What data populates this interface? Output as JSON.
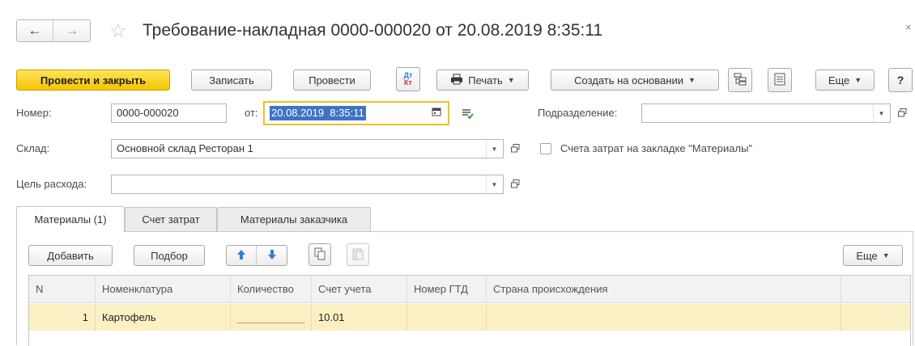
{
  "window": {
    "title": "Требование-накладная 0000-000020 от 20.08.2019 8:35:11",
    "back_icon": "arrow-left-icon",
    "forward_icon": "arrow-right-icon",
    "favorite_icon": "star-icon",
    "close_icon": "close-icon"
  },
  "toolbar": {
    "post_and_close": "Провести и закрыть",
    "save": "Записать",
    "post": "Провести",
    "dt_kt_top": "Дт",
    "dt_kt_bottom": "Кт",
    "print": "Печать",
    "create_based_on": "Создать на основании",
    "more": "Еще",
    "help": "?"
  },
  "form": {
    "number_label": "Номер:",
    "number_value": "0000-000020",
    "date_label": "от:",
    "date_value": "20.08.2019  8:35:11",
    "division_label": "Подразделение:",
    "division_value": "",
    "warehouse_label": "Склад:",
    "warehouse_value": "Основной склад Ресторан 1",
    "cost_accounts_checkbox_label": "Счета затрат на закладке \"Материалы\"",
    "cost_accounts_checked": false,
    "purpose_label": "Цель расхода:",
    "purpose_value": ""
  },
  "tabs": [
    {
      "label": "Материалы (1)",
      "active": true
    },
    {
      "label": "Счет затрат",
      "active": false
    },
    {
      "label": "Материалы заказчика",
      "active": false
    }
  ],
  "table_toolbar": {
    "add": "Добавить",
    "pick": "Подбор",
    "more": "Еще"
  },
  "table": {
    "columns": [
      "N",
      "Номенклатура",
      "Количество",
      "Счет учета",
      "Номер ГТД",
      "Страна происхождения"
    ],
    "rows": [
      {
        "n": "1",
        "item": "Картофель",
        "quantity": "",
        "account": "10.01",
        "gtd": "",
        "country": ""
      }
    ]
  },
  "colors": {
    "primary_button": "#f5c400",
    "selected_row": "#fbf0c4",
    "focus_border": "#f0c020",
    "date_selection": "#3f73c4",
    "arrow_blue": "#2f7fd6"
  }
}
